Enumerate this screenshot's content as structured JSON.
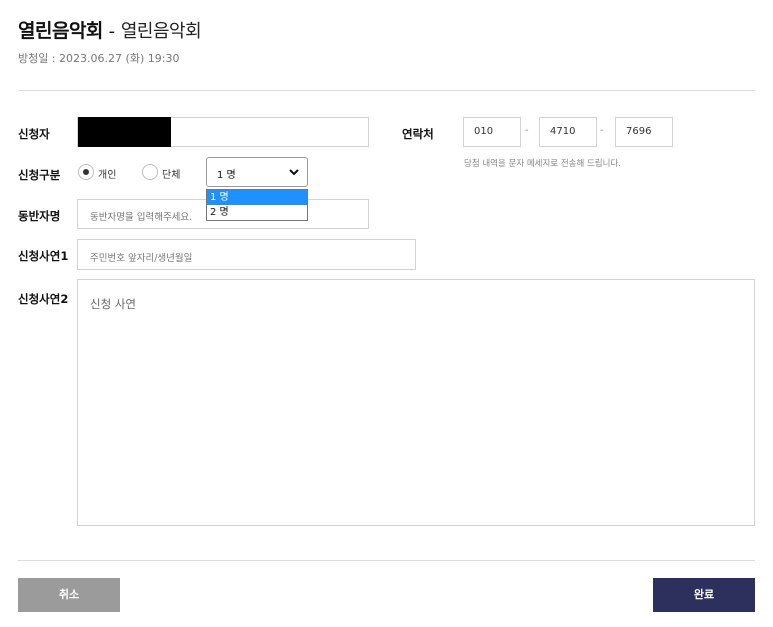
{
  "header": {
    "title_main": "열린음악회",
    "title_sep": " - ",
    "title_sub": "열린음악회",
    "broadcast_date": "방청일 : 2023.06.27 (화) 19:30"
  },
  "form": {
    "applicant_label": "신청자",
    "contact_label": "연락처",
    "phone": {
      "part1": "010",
      "part2": "4710",
      "part3": "7696",
      "dash": "-"
    },
    "phone_note": "당첨 내역을 문자 메세지로 전송해 드립니다.",
    "type_label": "신청구분",
    "type_options": [
      {
        "label": "개인",
        "checked": true
      },
      {
        "label": "단체",
        "checked": false
      }
    ],
    "count_select": {
      "value": "1 명",
      "options": [
        "1 명",
        "2 명"
      ],
      "highlighted": "1 명"
    },
    "companion_label": "동반자명",
    "companion_placeholder": "동반자명을 입력해주세요.",
    "reason1_label": "신청사연1",
    "reason1_placeholder": "주민번호 앞자리/생년월일",
    "reason2_label": "신청사연2",
    "reason2_placeholder": "신청 사연"
  },
  "buttons": {
    "cancel": "취소",
    "done": "완료"
  },
  "colors": {
    "done_button": "#2d2f5c",
    "cancel_button": "#9b9b9b",
    "dropdown_highlight": "#1e90ff"
  }
}
